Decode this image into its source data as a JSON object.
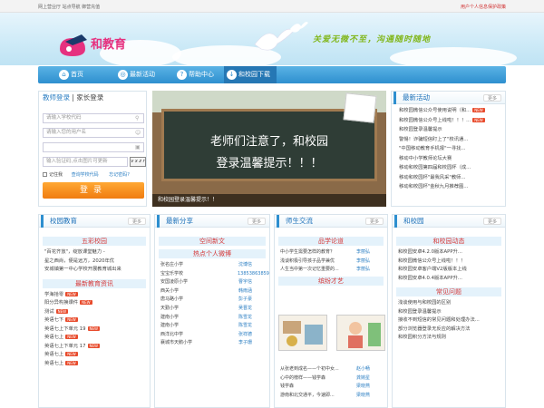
{
  "topbar": {
    "left": "网上营业厅 站点导航 御营充值",
    "right": "用户个人信息保护政策"
  },
  "header": {
    "logo_text": "和教育",
    "slogan": "关爱无微不至，沟通随时随地"
  },
  "nav": {
    "items": [
      {
        "label": "首页",
        "icon": "⌂"
      },
      {
        "label": "最新活动",
        "icon": "◎"
      },
      {
        "label": "帮助中心",
        "icon": "?"
      },
      {
        "label": "和校园下载",
        "icon": "↓"
      }
    ]
  },
  "login": {
    "tab_teacher": "教师登录",
    "tab_sep": "|",
    "tab_parent": "家长登录",
    "school_placeholder": "请输入学校代码",
    "user_placeholder": "请输入您的用户名",
    "password_placeholder": "",
    "captcha_placeholder": "输入验证码,点击图片可更新",
    "captcha_text": "v x z r",
    "remember": "记住我",
    "query_code": "查询学校代码",
    "forgot": "忘记密码?",
    "submit": "登录"
  },
  "banner": {
    "line1": "老师们注意了，和校园",
    "line2": "登录温馨提示！！！",
    "caption": "和校园登录温馨提示！！"
  },
  "activities": {
    "title": "最新活动",
    "more": "更多",
    "items": [
      {
        "text": "和校园微信公众号使用说明（和...",
        "new": true
      },
      {
        "text": "和校园微信公众号上线啦！！！...",
        "new": true
      },
      {
        "text": "和校园登录温馨提示",
        "new": false
      },
      {
        "text": "警惕！诈骗短信盯上了\"校讯通...",
        "new": false
      },
      {
        "text": "\"中国移动教育手机报\"一寻找...",
        "new": false
      },
      {
        "text": "移动中小学教师论坛大赛",
        "new": false
      },
      {
        "text": "移动和校园第四届和校园杯（成...",
        "new": false
      },
      {
        "text": "移动和校园杯\"最我风采\"教师...",
        "new": false
      },
      {
        "text": "移动和校园杯\"金秋九月推荐图...",
        "new": false
      }
    ]
  },
  "col1": {
    "title": "校园教育",
    "more": "更多",
    "section1": "五彩校园",
    "items1": [
      "\"百花齐放\"，绽放课堂魅力 -",
      "星之西尚，便是远方，2020年优",
      "安城镇第一中心学校开展教育城出来"
    ],
    "section2": "最新教育资讯",
    "items2": [
      {
        "text": "学海拾零",
        "new": true
      },
      {
        "text": "阳分异构换课件",
        "new": true
      },
      {
        "text": "测试",
        "new": true
      },
      {
        "text": "英语七下",
        "new": true
      },
      {
        "text": "英语七上下单元 19",
        "new": true
      },
      {
        "text": "英语七上",
        "new": true
      },
      {
        "text": "英语七上下单元 17",
        "new": true
      },
      {
        "text": "英语七上",
        "new": true
      },
      {
        "text": "英语七上",
        "new": true
      }
    ]
  },
  "col2": {
    "title": "最新分享",
    "more": "更多",
    "section1": "空间新文",
    "section2": "热点个人微博",
    "rows": [
      [
        "张名庄小学",
        "沈博信"
      ],
      [
        "宝宝乐学校",
        "13853863859"
      ],
      [
        "安国凌原小学",
        "曹宇信"
      ],
      [
        "西关小学",
        "韩雨涵"
      ],
      [
        "唐马路小学",
        "彭子豪"
      ],
      [
        "天勤小学",
        "吴晋龙"
      ],
      [
        "建南小学",
        "陈雪龙"
      ],
      [
        "建南小学",
        "陈雪龙"
      ],
      [
        "西洋北中学",
        "张祥德"
      ],
      [
        "襄城市天鹅小学",
        "李子珊"
      ]
    ]
  },
  "col3": {
    "title": "师生交流",
    "more": "更多",
    "section1": "品学论道",
    "rows1": [
      [
        "中小学生需要怎样的教育？",
        "李丽弘"
      ],
      [
        "浅谈积极引导孩子品学兼优",
        "李丽弘"
      ],
      [
        "人生当中第一次记忆重要的...",
        "李丽弘"
      ]
    ],
    "section2": "缤纷才艺",
    "rows2": [
      [
        "从张老到成名——个初中女...",
        "赵小畅"
      ],
      [
        "心中的榜样——钱学森",
        "龚婉星"
      ],
      [
        "钱学森",
        "梁晓燕"
      ],
      [
        "游南和北交通平，今速即...",
        "梁晓燕"
      ]
    ]
  },
  "col4": {
    "title": "和校园",
    "more": "更多",
    "section1": "和校园动态",
    "items1": [
      "和校园安卓4.2.0版本APP升...",
      "和校园微信公众号上线啦！！！",
      "和校园安卓客户端V2版版本上线",
      "和校园安卓4.0.4版本APP升..."
    ],
    "section2": "常见问题",
    "items2": [
      "浅谈使用与和校园的区别",
      "和校园登录温馨提示",
      "接收不到短信的常见问题和处理办法...",
      "部分浏览器登录无反应的解决方法",
      "和校园积分方法与规则"
    ]
  }
}
